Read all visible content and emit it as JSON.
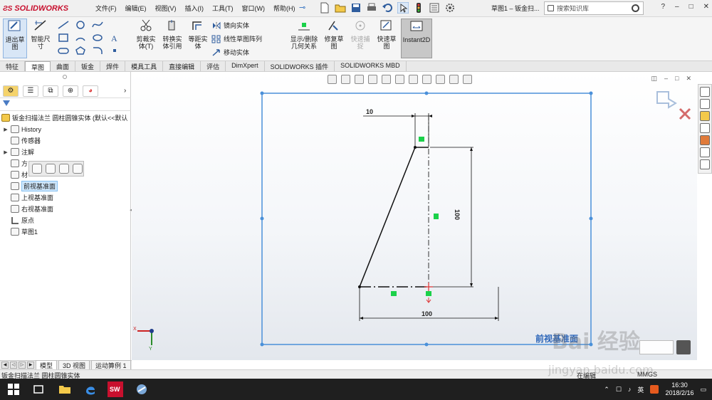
{
  "app": {
    "brand": "SOLIDWORKS",
    "menus": [
      "文件(F)",
      "编辑(E)",
      "视图(V)",
      "插入(I)",
      "工具(T)",
      "窗口(W)",
      "帮助(H)"
    ],
    "doc_title": "草图1 – 钣金扫...",
    "search_placeholder": "搜索知识库",
    "help_label": "?",
    "window_controls": [
      "–",
      "□",
      "✕"
    ]
  },
  "ribbon": {
    "exit_sketch": "退出草\n图",
    "smart_dimension": "智能尺\n寸",
    "trim": "剪裁实\n体(T)",
    "convert": "转换实\n体引用",
    "offset": "等距实\n体",
    "mirror": "镜向实体",
    "linear_pattern": "线性草图阵列",
    "move": "移动实体",
    "display_delete": "显示/删除\n几何关系",
    "repair": "修复草\n图",
    "quick_snaps": "快速捕\n捉",
    "rapid_sketch": "快速草\n图",
    "instant2d": "Instant2D"
  },
  "tabs": [
    "特征",
    "草图",
    "曲面",
    "钣金",
    "焊件",
    "模具工具",
    "直接编辑",
    "评估",
    "DimXpert",
    "SOLIDWORKS 插件",
    "SOLIDWORKS MBD"
  ],
  "active_tab": "草图",
  "tree": {
    "root": "钣金扫描法兰 圆柱圆锥实体  (默认<<默认",
    "items": [
      {
        "label": "History",
        "expandable": true
      },
      {
        "label": "传感器",
        "expandable": false
      },
      {
        "label": "注解",
        "expandable": true
      },
      {
        "label": "方",
        "expandable": false
      },
      {
        "label": "材",
        "expandable": false
      },
      {
        "label": "前视基准面",
        "expandable": false,
        "selected": true
      },
      {
        "label": "上视基准面",
        "expandable": false
      },
      {
        "label": "右视基准面",
        "expandable": false
      },
      {
        "label": "原点",
        "expandable": false
      },
      {
        "label": "草图1",
        "expandable": false
      }
    ]
  },
  "sketch": {
    "dim_top": "10",
    "dim_vertical": "100",
    "dim_bottom": "100",
    "plane_label": "前视基准面",
    "axis_y": "Y",
    "axis_x": "X"
  },
  "bottom_tabs": [
    "模型",
    "3D 视图",
    "运动算例 1"
  ],
  "active_bottom_tab": "模型",
  "status": {
    "left": "钣金扫描法兰 圆柱圆锥实体",
    "mid": "在编辑",
    "right": "MMGS"
  },
  "taskbar": {
    "ime": "英",
    "time": "16:30",
    "date": "2018/2/16"
  },
  "watermark": {
    "main": "Bai 经验",
    "sub": "jingyan.baidu.com"
  },
  "colors": {
    "accent": "#1e5ea8",
    "sketch_blue": "#4a90d9",
    "relation_green": "#1bd14a",
    "brand_red": "#c8102e"
  }
}
